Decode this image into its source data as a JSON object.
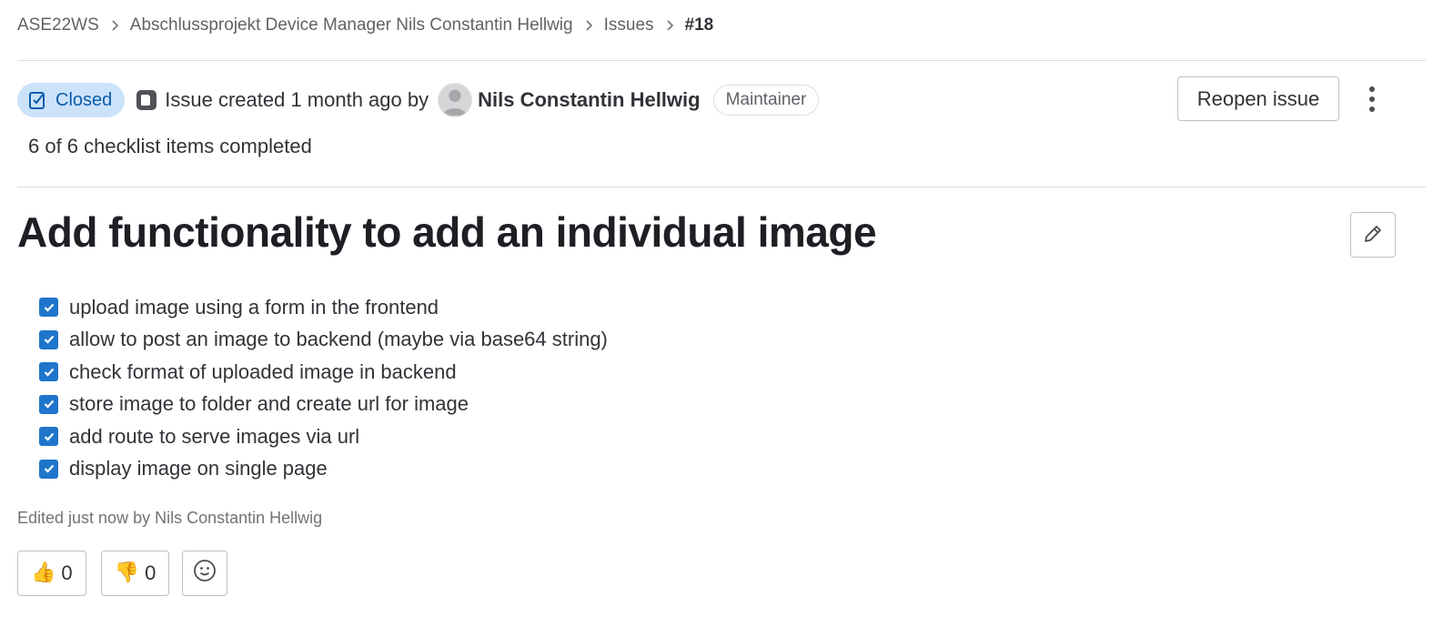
{
  "breadcrumb": {
    "items": [
      "ASE22WS",
      "Abschlussprojekt Device Manager Nils Constantin Hellwig",
      "Issues"
    ],
    "current": "#18"
  },
  "header": {
    "status": "Closed",
    "created_text": "Issue created 1 month ago by",
    "author": "Nils Constantin Hellwig",
    "role": "Maintainer",
    "reopen_label": "Reopen issue",
    "checklist_summary": "6 of 6 checklist items completed"
  },
  "issue": {
    "title": "Add functionality to add an individual image",
    "tasks": [
      {
        "label": "upload image using a form in the frontend",
        "checked": true
      },
      {
        "label": "allow to post an image to backend (maybe via base64 string)",
        "checked": true
      },
      {
        "label": "check format of uploaded image in backend",
        "checked": true
      },
      {
        "label": "store image to folder and create url for image",
        "checked": true
      },
      {
        "label": "add route to serve images via url",
        "checked": true
      },
      {
        "label": "display image on single page",
        "checked": true
      }
    ],
    "edited_note": "Edited just now by Nils Constantin Hellwig"
  },
  "reactions": {
    "thumbs_up": {
      "emoji": "👍",
      "count": "0"
    },
    "thumbs_down": {
      "emoji": "👎",
      "count": "0"
    }
  },
  "colors": {
    "status_bg": "#cbe2f9",
    "status_fg": "#0b5cad",
    "checkbox": "#1f75cb"
  },
  "icons": [
    "chevron-right-icon",
    "issue-closed-icon",
    "issue-type-icon",
    "kebab-vertical-icon",
    "pencil-icon",
    "check-icon",
    "smiley-icon"
  ]
}
